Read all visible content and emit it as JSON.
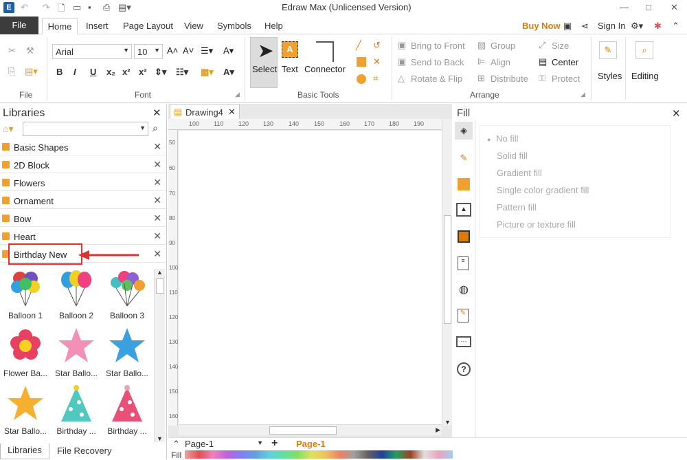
{
  "app": {
    "title": "Edraw Max (Unlicensed Version)"
  },
  "window_controls": {
    "minimize": "—",
    "maximize": "□",
    "close": "✕"
  },
  "menu": {
    "file": "File",
    "home": "Home",
    "insert": "Insert",
    "page_layout": "Page Layout",
    "view": "View",
    "symbols": "Symbols",
    "help": "Help"
  },
  "header_right": {
    "buy_now": "Buy Now",
    "sign_in": "Sign In"
  },
  "ribbon": {
    "font_name": "Arial",
    "font_size": "10",
    "groups": {
      "file": "File",
      "font": "Font",
      "basic_tools": "Basic Tools",
      "arrange": "Arrange"
    },
    "select": "Select",
    "text": "Text",
    "connector": "Connector",
    "bring_to_front": "Bring to Front",
    "send_to_back": "Send to Back",
    "rotate_flip": "Rotate & Flip",
    "group": "Group",
    "align": "Align",
    "distribute": "Distribute",
    "size": "Size",
    "center": "Center",
    "protect": "Protect",
    "styles": "Styles",
    "editing": "Editing",
    "bold": "B",
    "italic": "I",
    "underline": "U"
  },
  "libraries": {
    "title": "Libraries",
    "search_placeholder": "",
    "categories": [
      "Basic Shapes",
      "2D Block",
      "Flowers",
      "Ornament",
      "Bow",
      "Heart",
      "Birthday New"
    ],
    "shapes": [
      "Balloon 1",
      "Balloon 2",
      "Balloon 3",
      "Flower Ba...",
      "Star Ballo...",
      "Star Ballo...",
      "Star Ballo...",
      "Birthday ...",
      "Birthday ..."
    ],
    "tabs": {
      "libraries": "Libraries",
      "file_recovery": "File Recovery"
    }
  },
  "document": {
    "tab": "Drawing4",
    "ruler_h": [
      "100",
      "110",
      "120",
      "130",
      "140",
      "150",
      "160",
      "170",
      "180",
      "190"
    ],
    "ruler_v": [
      "50",
      "60",
      "70",
      "80",
      "90",
      "100",
      "110",
      "120",
      "130",
      "140",
      "150",
      "160"
    ]
  },
  "fill_panel": {
    "title": "Fill",
    "options": [
      "No fill",
      "Solid fill",
      "Gradient fill",
      "Single color gradient fill",
      "Pattern fill",
      "Picture or texture fill"
    ]
  },
  "bottom": {
    "page_select": "Page-1",
    "page_tab": "Page-1",
    "fill_label": "Fill"
  },
  "colors": {
    "accent": "#e07b00",
    "highlight_box": "#e03030",
    "file_tab": "#3c3c3c"
  }
}
